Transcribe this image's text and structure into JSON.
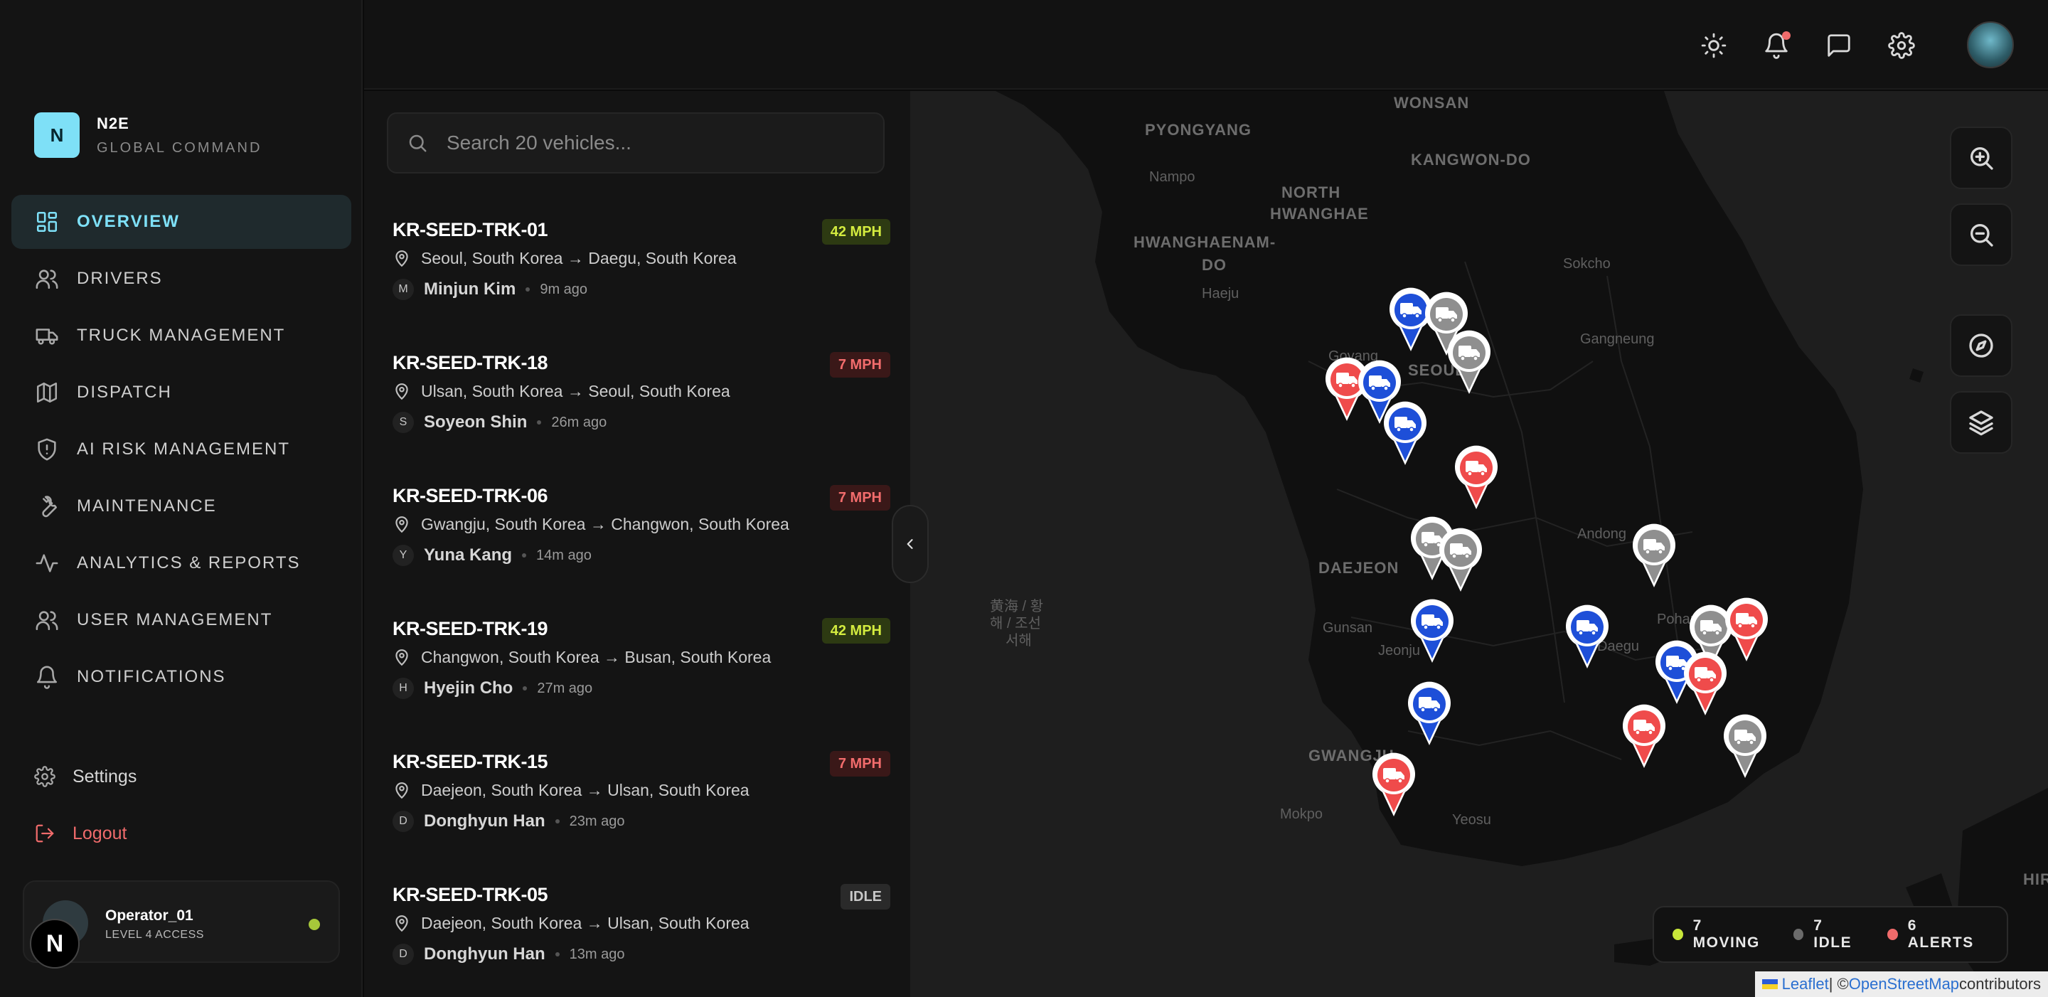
{
  "brand": {
    "logo_letter": "N",
    "title": "N2E",
    "subtitle": "GLOBAL COMMAND"
  },
  "nav": [
    {
      "label": "OVERVIEW",
      "icon": "grid-icon",
      "active": true
    },
    {
      "label": "DRIVERS",
      "icon": "users-icon"
    },
    {
      "label": "TRUCK MANAGEMENT",
      "icon": "truck-icon"
    },
    {
      "label": "DISPATCH",
      "icon": "map-icon"
    },
    {
      "label": "AI RISK MANAGEMENT",
      "icon": "shield-icon"
    },
    {
      "label": "MAINTENANCE",
      "icon": "wrench-icon"
    },
    {
      "label": "ANALYTICS & REPORTS",
      "icon": "activity-icon"
    },
    {
      "label": "USER MANAGEMENT",
      "icon": "users-icon"
    },
    {
      "label": "NOTIFICATIONS",
      "icon": "bell-icon"
    }
  ],
  "footer": {
    "settings_label": "Settings",
    "logout_label": "Logout"
  },
  "operator": {
    "name": "Operator_01",
    "level": "LEVEL 4 ACCESS",
    "status_color": "#a6c73a",
    "badge": "N"
  },
  "topbar": {
    "icons": [
      "sun-icon",
      "bell-icon",
      "message-icon",
      "gear-icon",
      "avatar"
    ]
  },
  "search": {
    "placeholder": "Search 20 vehicles...",
    "value": ""
  },
  "vehicles": [
    {
      "id": "KR-SEED-TRK-01",
      "badge": "42 MPH",
      "status": "moving",
      "route": "Seoul, South Korea → Daegu, South Korea",
      "initial": "M",
      "driver": "Minjun Kim",
      "time": "9m ago"
    },
    {
      "id": "KR-SEED-TRK-18",
      "badge": "7 MPH",
      "status": "alert",
      "route": "Ulsan, South Korea → Seoul, South Korea",
      "initial": "S",
      "driver": "Soyeon Shin",
      "time": "26m ago"
    },
    {
      "id": "KR-SEED-TRK-06",
      "badge": "7 MPH",
      "status": "alert",
      "route": "Gwangju, South Korea → Changwon, South Korea",
      "initial": "Y",
      "driver": "Yuna Kang",
      "time": "14m ago"
    },
    {
      "id": "KR-SEED-TRK-19",
      "badge": "42 MPH",
      "status": "moving",
      "route": "Changwon, South Korea → Busan, South Korea",
      "initial": "H",
      "driver": "Hyejin Cho",
      "time": "27m ago"
    },
    {
      "id": "KR-SEED-TRK-15",
      "badge": "7 MPH",
      "status": "alert",
      "route": "Daejeon, South Korea → Ulsan, South Korea",
      "initial": "D",
      "driver": "Donghyun Han",
      "time": "23m ago"
    },
    {
      "id": "KR-SEED-TRK-05",
      "badge": "IDLE",
      "status": "idle",
      "route": "Daejeon, South Korea → Ulsan, South Korea",
      "initial": "D",
      "driver": "Donghyun Han",
      "time": "13m ago"
    }
  ],
  "map": {
    "labels": [
      {
        "text": "WONSAN",
        "cls": ""
      },
      {
        "text": "PYONGYANG",
        "cls": ""
      },
      {
        "text": "KANGWON-DO",
        "cls": ""
      },
      {
        "text": "Nampo",
        "cls": "small"
      },
      {
        "text": "NORTH",
        "cls": ""
      },
      {
        "text": "HWANGHAE",
        "cls": ""
      },
      {
        "text": "HWANGHAENAM-",
        "cls": ""
      },
      {
        "text": "DO",
        "cls": ""
      },
      {
        "text": "Sokcho",
        "cls": "small"
      },
      {
        "text": "Haeju",
        "cls": "small"
      },
      {
        "text": "Gangneung",
        "cls": "small"
      },
      {
        "text": "Goyang",
        "cls": "small"
      },
      {
        "text": "SEOUL",
        "cls": ""
      },
      {
        "text": "Andong",
        "cls": "small"
      },
      {
        "text": "DAEJEON",
        "cls": ""
      },
      {
        "text": "黄海 / 황",
        "cls": "small"
      },
      {
        "text": "해 / 조선",
        "cls": "small"
      },
      {
        "text": "서해",
        "cls": "small"
      },
      {
        "text": "Gunsan",
        "cls": "small"
      },
      {
        "text": "Jeonju",
        "cls": "small"
      },
      {
        "text": "Pohang",
        "cls": "small"
      },
      {
        "text": "Daegu",
        "cls": "small"
      },
      {
        "text": "GWANGJU",
        "cls": ""
      },
      {
        "text": "Mokpo",
        "cls": "small"
      },
      {
        "text": "Yeosu",
        "cls": "small"
      },
      {
        "text": "HIR",
        "cls": ""
      }
    ],
    "pins": [
      {
        "status": "moving"
      },
      {
        "status": "idle"
      },
      {
        "status": "idle"
      },
      {
        "status": "alert"
      },
      {
        "status": "moving"
      },
      {
        "status": "moving"
      },
      {
        "status": "alert"
      },
      {
        "status": "idle"
      },
      {
        "status": "idle"
      },
      {
        "status": "idle"
      },
      {
        "status": "moving"
      },
      {
        "status": "moving"
      },
      {
        "status": "alert"
      },
      {
        "status": "moving"
      },
      {
        "status": "idle"
      },
      {
        "status": "alert"
      },
      {
        "status": "moving"
      },
      {
        "status": "alert"
      },
      {
        "status": "idle"
      },
      {
        "status": "alert"
      }
    ],
    "controls": [
      "zoom-in-icon",
      "zoom-out-icon",
      "compass-icon",
      "layers-icon"
    ],
    "legend": [
      {
        "label": "7 MOVING",
        "color": "#c8e63a"
      },
      {
        "label": "7 IDLE",
        "color": "#6b6b6b"
      },
      {
        "label": "6 ALERTS",
        "color": "#f06b6b"
      }
    ],
    "attribution": {
      "leaflet": "Leaflet",
      "sep": " | © ",
      "osm": "OpenStreetMap",
      "suffix": " contributors"
    }
  },
  "colors": {
    "accent": "#7ee0f7",
    "moving_pin": "#1e4fd8",
    "idle_pin": "#8f8f8f",
    "alert_pin": "#ef4b4b"
  }
}
